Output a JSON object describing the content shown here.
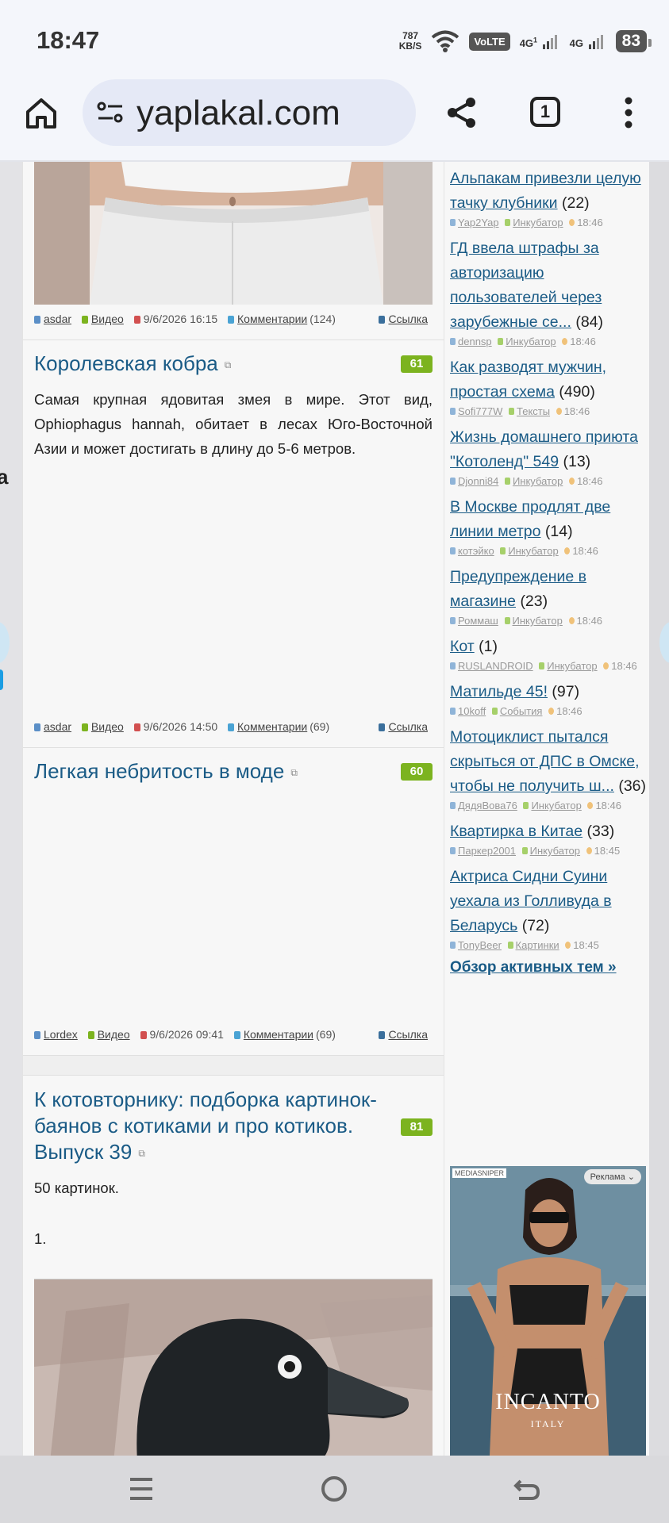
{
  "status": {
    "time": "18:47",
    "speed_value": "787",
    "speed_unit": "KB/S",
    "volte": "VoLTE",
    "sim1": "4G",
    "sim1_sup": "1",
    "sim2": "4G",
    "battery": "83"
  },
  "browser": {
    "url": "yaplakal.com",
    "tab_count": "1"
  },
  "posts": [
    {
      "author": "asdar",
      "category": "Видео",
      "date": "9/6/2026 16:15",
      "comments": "Комментарии",
      "comments_count": "(124)",
      "link": "Ссылка"
    },
    {
      "title": "Королевская кобра",
      "rating": "61",
      "text": "Самая крупная ядовитая змея в мире. Этот вид, Ophiophagus hannah, обитает в лесах Юго-Восточной Азии и может достигать в длину до 5-6 метров.",
      "author": "asdar",
      "category": "Видео",
      "date": "9/6/2026 14:50",
      "comments": "Комментарии",
      "comments_count": "(69)",
      "link": "Ссылка"
    },
    {
      "title": "Легкая небритость в моде",
      "rating": "60",
      "author": "Lordex",
      "category": "Видео",
      "date": "9/6/2026 09:41",
      "comments": "Комментарии",
      "comments_count": "(69)",
      "link": "Ссылка"
    },
    {
      "title": "К котовторнику: подборка картинок-баянов с котиками и про котиков. Выпуск 39",
      "rating": "81",
      "text1": "50 картинок.",
      "text2": "1."
    }
  ],
  "sidebar": {
    "items": [
      {
        "title": "Альпакам привезли целую тачку клубники",
        "count": "(22)",
        "user": "Yap2Yap",
        "section": "Инкубатор",
        "time": "18:46"
      },
      {
        "title": "ГД ввела штрафы за авторизацию пользователей через зарубежные се...",
        "count": "(84)",
        "user": "dennsp",
        "section": "Инкубатор",
        "time": "18:46"
      },
      {
        "title": "Как разводят мужчин, простая схема",
        "count": "(490)",
        "user": "Sofi777W",
        "section": "Тексты",
        "time": "18:46"
      },
      {
        "title": "Жизнь домашнего приюта \"Котоленд\" 549",
        "count": "(13)",
        "user": "Djonni84",
        "section": "Инкубатор",
        "time": "18:46"
      },
      {
        "title": "В Москве продлят две линии метро",
        "count": "(14)",
        "user": "котэйко",
        "section": "Инкубатор",
        "time": "18:46"
      },
      {
        "title": "Предупреждение в магазине",
        "count": "(23)",
        "user": "Роммаш",
        "section": "Инкубатор",
        "time": "18:46"
      },
      {
        "title": "Кот",
        "count": "(1)",
        "user": "RUSLANDROID",
        "section": "Инкубатор",
        "time": "18:46"
      },
      {
        "title": "Матильде 45!",
        "count": "(97)",
        "user": "10koff",
        "section": "События",
        "time": "18:46"
      },
      {
        "title": "Мотоциклист пытался скрыться от ДПС в Омске, чтобы не получить ш...",
        "count": "(36)",
        "user": "ДядяВова76",
        "section": "Инкубатор",
        "time": "18:46"
      },
      {
        "title": "Квартирка в Китае",
        "count": "(33)",
        "user": "Паркер2001",
        "section": "Инкубатор",
        "time": "18:45"
      },
      {
        "title": "Актриса Сидни Суини уехала из Голливуда в Беларусь",
        "count": "(72)",
        "user": "TonyBeer",
        "section": "Картинки",
        "time": "18:45"
      }
    ],
    "overview": "Обзор активных тем »"
  },
  "ad": {
    "network": "MEDIASNIPER",
    "label": "Реклама",
    "brand": "INCANTO",
    "sub": "ITALY"
  },
  "edge": {
    "char": "a"
  }
}
